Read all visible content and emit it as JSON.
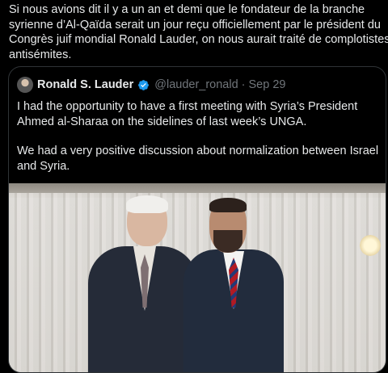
{
  "post": {
    "text_lines": [
      "Si nous avions dit il y a un an et demi que le fondateur de la branche",
      "syrienne d’Al-Qaïda serait un jour reçu officiellement par le président du",
      "Congrès juif mondial Ronald Lauder, on nous aurait traité de complotistes",
      "antisémites."
    ]
  },
  "quoted_post": {
    "name": "Ronald S. Lauder",
    "handle": "@lauder_ronald",
    "separator": "·",
    "date": "Sep 29",
    "paragraph1_lines": [
      "I had the opportunity to have a first meeting with Syria’s President",
      "Ahmed al-Sharaa on the sidelines of last week’s UNGA."
    ],
    "paragraph2_lines": [
      "We had a very positive discussion about normalization between Israel",
      "and Syria."
    ]
  },
  "colors": {
    "background": "#000000",
    "text": "#e7e9ea",
    "secondary_text": "#71767b",
    "border": "#2f3336",
    "verified_badge": "#1d9bf0"
  },
  "icons": {
    "verified": "verified-badge-icon"
  }
}
